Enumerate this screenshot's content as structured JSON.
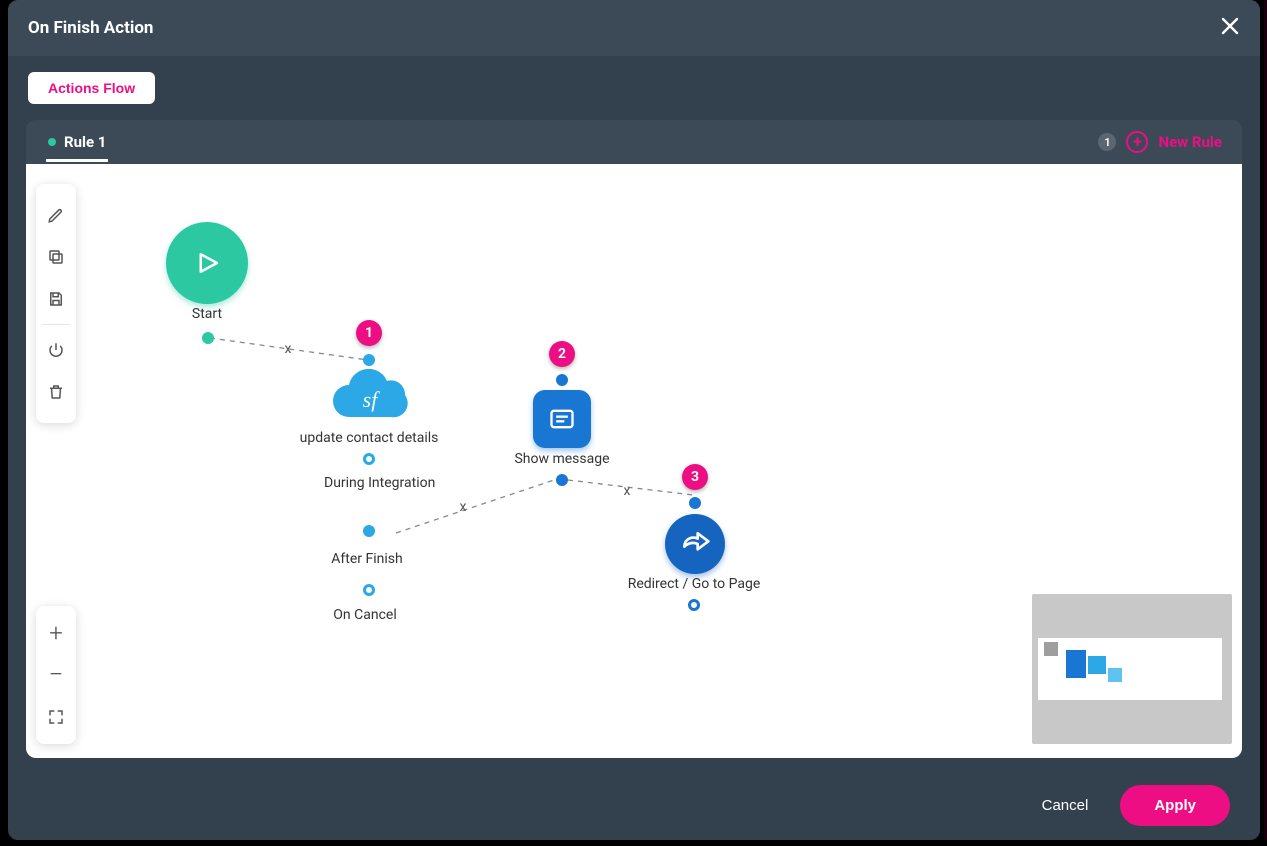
{
  "modal": {
    "title": "On Finish Action",
    "actions_flow_label": "Actions Flow",
    "rule_tab_label": "Rule 1",
    "rule_count": "1",
    "new_rule_label": "New Rule"
  },
  "flow": {
    "start_label": "Start",
    "node1": {
      "badge": "1",
      "label": "update contact details",
      "cloud_text": "sf",
      "sub1": "During Integration",
      "sub2": "After Finish",
      "sub3": "On Cancel"
    },
    "node2": {
      "badge": "2",
      "label": "Show message"
    },
    "node3": {
      "badge": "3",
      "label": "Redirect / Go to Page"
    },
    "conn_sym": "x"
  },
  "footer": {
    "cancel": "Cancel",
    "apply": "Apply"
  }
}
